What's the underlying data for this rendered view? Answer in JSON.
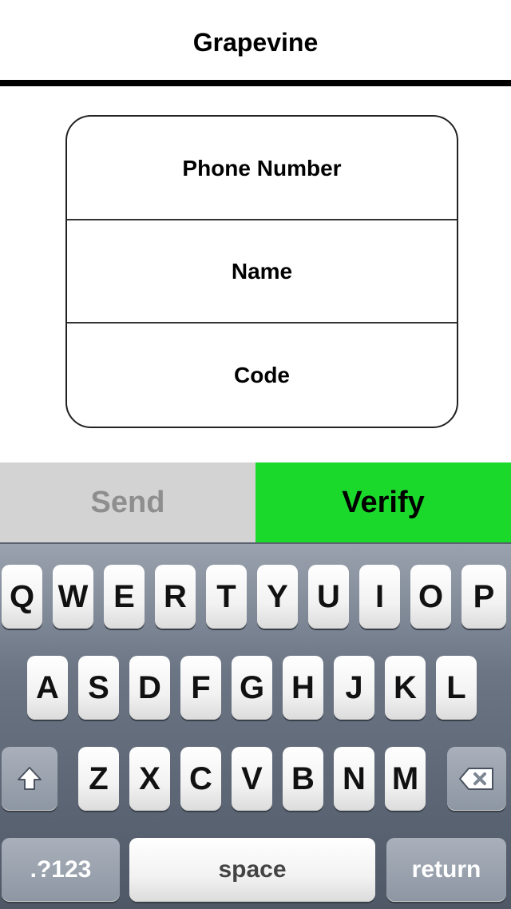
{
  "nav": {
    "title": "Grapevine"
  },
  "form": {
    "fields": [
      {
        "placeholder": "Phone Number"
      },
      {
        "placeholder": "Name"
      },
      {
        "placeholder": "Code"
      }
    ]
  },
  "actions": {
    "send_label": "Send",
    "verify_label": "Verify",
    "send_color": "#d3d3d3",
    "verify_color": "#1bd92b"
  },
  "keyboard": {
    "row1": [
      "Q",
      "W",
      "E",
      "R",
      "T",
      "Y",
      "U",
      "I",
      "O",
      "P"
    ],
    "row2": [
      "A",
      "S",
      "D",
      "F",
      "G",
      "H",
      "J",
      "K",
      "L"
    ],
    "row3": [
      "Z",
      "X",
      "C",
      "V",
      "B",
      "N",
      "M"
    ],
    "shift_icon": "shift-icon",
    "backspace_icon": "backspace-icon",
    "numbers_label": ".?123",
    "space_label": "space",
    "return_label": "return"
  }
}
